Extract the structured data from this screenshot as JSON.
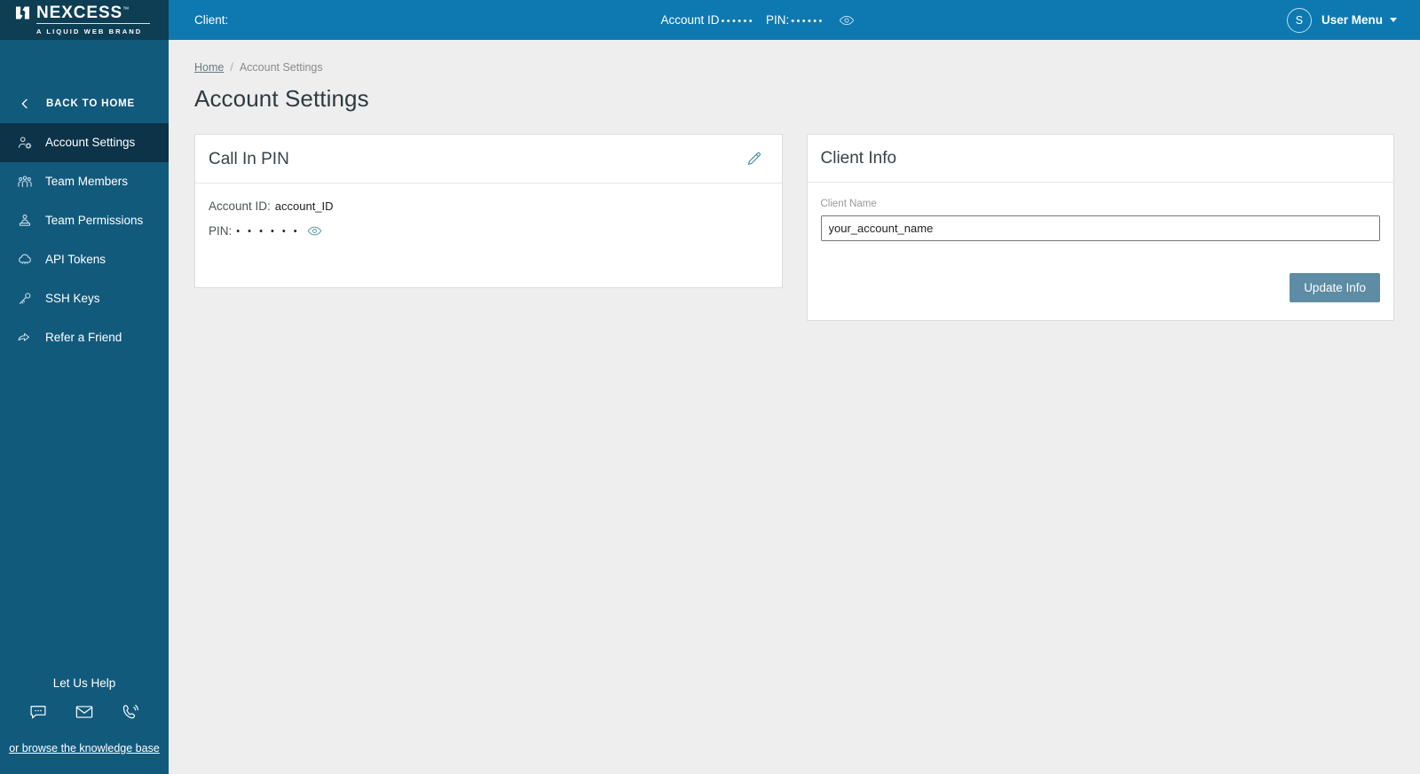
{
  "brand": {
    "name": "NEXCESS",
    "trademark": "™",
    "tagline": "A LIQUID WEB BRAND",
    "logo_icon": "nexcess-logo-icon"
  },
  "sidebar": {
    "back_label": "BACK TO HOME",
    "back_icon": "chevron-left-icon",
    "items": [
      {
        "label": "Account Settings",
        "icon": "user-gear-icon",
        "active": true
      },
      {
        "label": "Team Members",
        "icon": "people-group-icon",
        "active": false
      },
      {
        "label": "Team Permissions",
        "icon": "user-badge-icon",
        "active": false
      },
      {
        "label": "API Tokens",
        "icon": "cloud-icon",
        "active": false
      },
      {
        "label": "SSH Keys",
        "icon": "key-icon",
        "active": false
      },
      {
        "label": "Refer a Friend",
        "icon": "share-arrow-icon",
        "active": false
      }
    ],
    "help": {
      "title": "Let Us Help",
      "icons": [
        "chat-bubble-icon",
        "envelope-icon",
        "phone-ring-icon"
      ],
      "link": "or browse the knowledge base"
    }
  },
  "topbar": {
    "client_label": "Client:",
    "account_id_label": "Account ID",
    "account_id_masked": "••••••",
    "pin_label": "PIN:",
    "pin_masked": "••••••",
    "reveal_icon": "eye-icon",
    "avatar_initial": "S",
    "user_menu_label": "User Menu",
    "caret_icon": "caret-down-icon"
  },
  "breadcrumb": {
    "home": "Home",
    "separator": "/",
    "current": "Account Settings"
  },
  "page": {
    "title": "Account Settings"
  },
  "call_in_pin_card": {
    "title": "Call In PIN",
    "edit_icon": "pencil-edit-icon",
    "account_id_label": "Account ID:",
    "account_id_value": "account_ID",
    "pin_label": "PIN:",
    "pin_masked": "• • • • • •",
    "pin_reveal_icon": "eye-icon"
  },
  "client_info_card": {
    "title": "Client Info",
    "client_name_label": "Client Name",
    "client_name_value": "your_account_name",
    "client_name_placeholder": "Client Name",
    "update_button_label": "Update Info"
  },
  "colors": {
    "sidebar_bg": "#125a7c",
    "sidebar_active_bg": "#0c3348",
    "logo_bg": "#0d3e54",
    "topbar_bg": "#0e79b0",
    "page_bg": "#eeeeee",
    "accent_teal": "#3e8aa3",
    "button_bg": "#5d8ca4",
    "card_bg": "#ffffff"
  }
}
